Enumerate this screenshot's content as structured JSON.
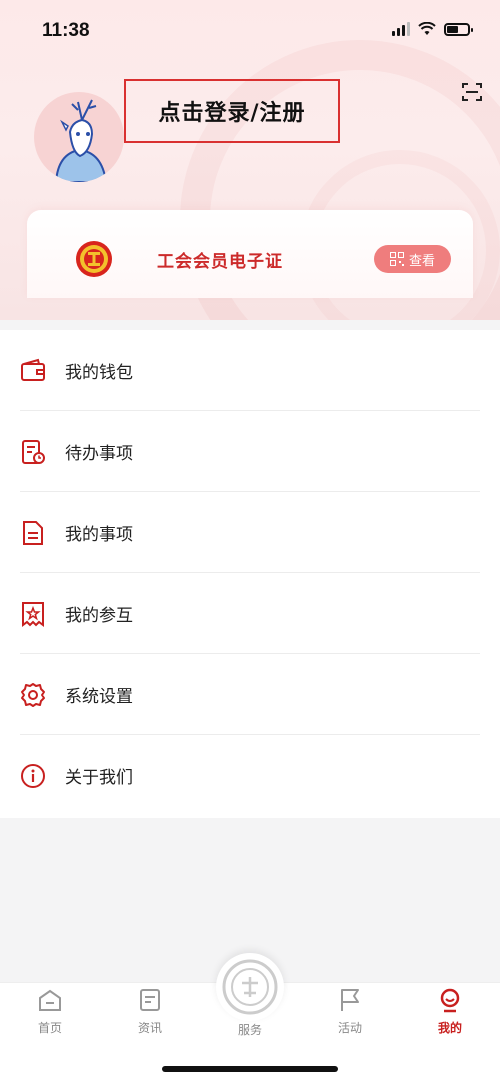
{
  "status_bar": {
    "time": "11:38"
  },
  "header": {
    "login_text": "点击登录/注册"
  },
  "member_card": {
    "title": "工会会员电子证",
    "view_label": "查看"
  },
  "menu": {
    "items": [
      {
        "label": "我的钱包",
        "icon": "wallet-icon"
      },
      {
        "label": "待办事项",
        "icon": "todo-icon"
      },
      {
        "label": "我的事项",
        "icon": "document-icon"
      },
      {
        "label": "我的参互",
        "icon": "star-card-icon"
      },
      {
        "label": "系统设置",
        "icon": "gear-icon"
      },
      {
        "label": "关于我们",
        "icon": "info-icon"
      }
    ]
  },
  "tabbar": {
    "tabs": [
      {
        "label": "首页",
        "icon": "home-icon"
      },
      {
        "label": "资讯",
        "icon": "news-icon"
      },
      {
        "label": "服务",
        "icon": "service-icon"
      },
      {
        "label": "活动",
        "icon": "flag-icon"
      },
      {
        "label": "我的",
        "icon": "profile-icon"
      }
    ],
    "active_index": 4
  },
  "colors": {
    "accent": "#c8201f",
    "view_button": "#ef7d7d",
    "header_bg": "#fde9e9"
  }
}
